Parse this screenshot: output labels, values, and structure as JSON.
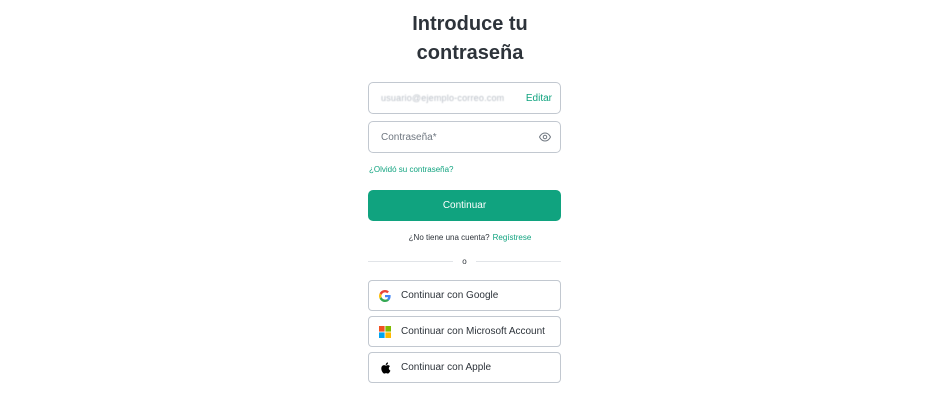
{
  "heading": {
    "line1": "Introduce tu",
    "line2": "contraseña"
  },
  "email": {
    "value": "usuario@ejemplo-correo.com",
    "edit_label": "Editar"
  },
  "password": {
    "placeholder": "Contraseña*"
  },
  "forgot_link": "¿Olvidó su contraseña?",
  "continue_button": "Continuar",
  "signup": {
    "prompt": "¿No tiene una cuenta?",
    "link": "Regístrese"
  },
  "divider_text": "O",
  "social": {
    "google": "Continuar con Google",
    "microsoft": "Continuar con Microsoft Account",
    "apple": "Continuar con Apple"
  },
  "colors": {
    "accent": "#10a37f",
    "border": "#c2c8d0",
    "text": "#2d333a"
  }
}
